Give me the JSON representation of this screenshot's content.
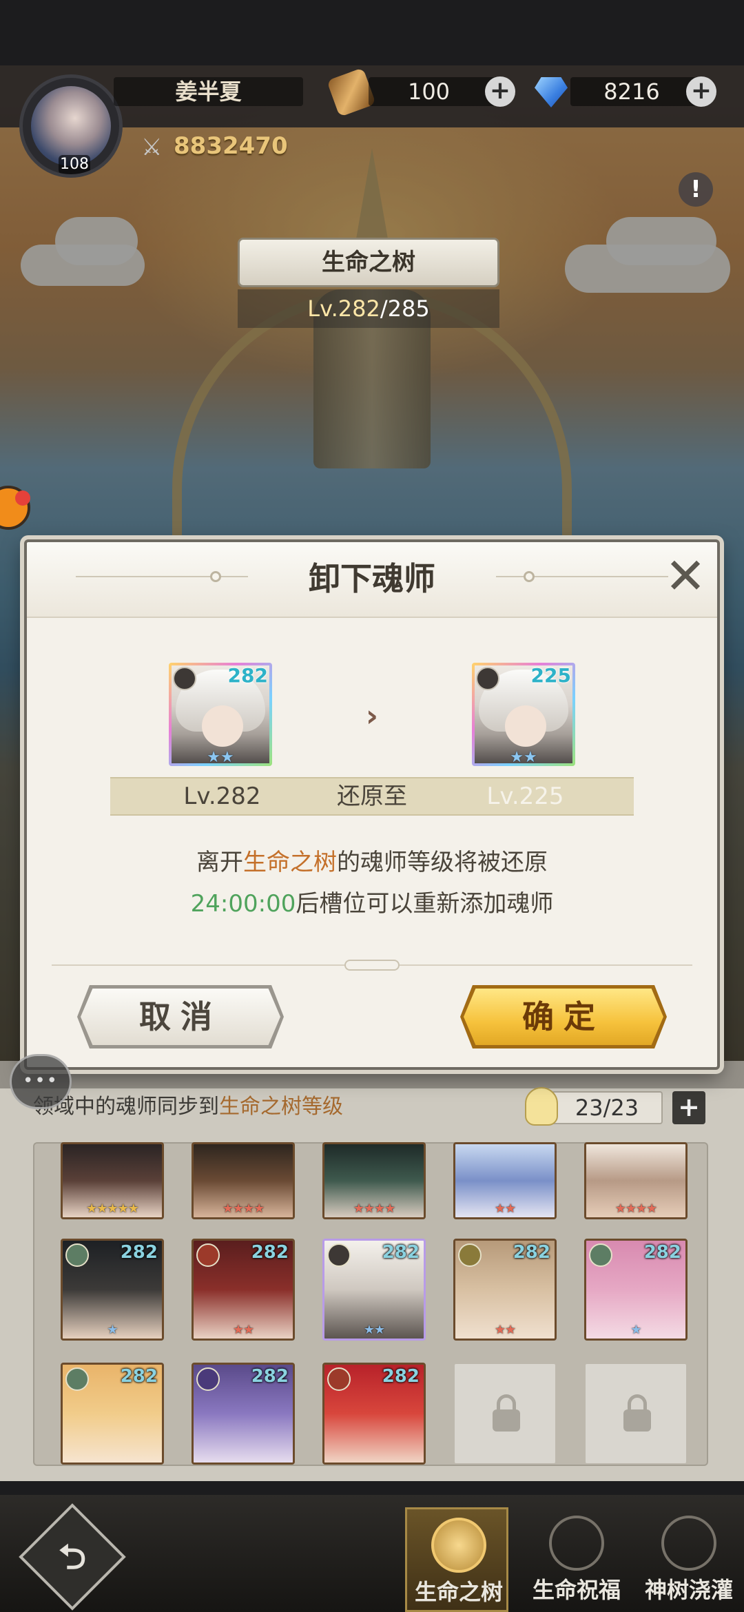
{
  "player": {
    "name": "姜半夏",
    "level": "108",
    "power": "8832470"
  },
  "resources": [
    {
      "icon": "scroll-icon",
      "value": "100"
    },
    {
      "icon": "gem-icon",
      "value": "8216"
    }
  ],
  "tree": {
    "title": "生命之树",
    "level_current": "Lv.282",
    "level_max": "/285"
  },
  "dialog": {
    "title": "卸下魂师",
    "from_level_badge": "282",
    "to_level_badge": "225",
    "from_level": "Lv.282",
    "restore_label": "还原至",
    "to_level": "Lv.225",
    "msg1_a": "离开",
    "msg1_b": "生命之树",
    "msg1_c": "的魂师等级将被还原",
    "msg2_a": "24:00:00",
    "msg2_b": "后槽位可以重新添加魂师",
    "cancel_label": "取消",
    "confirm_label": "确定"
  },
  "domain_panel": {
    "sync_text_a": "领域中的魂师同步到",
    "sync_text_b": "生命之树等级",
    "slot_count": "23/23",
    "slots_row1": [
      {
        "stars": "★★★★★",
        "star_class": "stars"
      },
      {
        "stars": "★★★★",
        "star_class": "stars red"
      },
      {
        "stars": "★★★★",
        "star_class": "stars red"
      },
      {
        "stars": "★★",
        "star_class": "stars red"
      },
      {
        "stars": "★★★★",
        "star_class": "stars red"
      }
    ],
    "slots_row2": [
      {
        "level": "282",
        "stars": "★",
        "star_class": "stars blue"
      },
      {
        "level": "282",
        "stars": "★★",
        "star_class": "stars red"
      },
      {
        "level": "282",
        "stars": "★★",
        "star_class": "stars blue"
      },
      {
        "level": "282",
        "stars": "★★",
        "star_class": "stars red"
      },
      {
        "level": "282",
        "stars": "★",
        "star_class": "stars blue"
      }
    ],
    "slots_row3": [
      {
        "level": "282"
      },
      {
        "level": "282"
      },
      {
        "level": "282"
      }
    ]
  },
  "bottom_nav": {
    "back_glyph": "⮌",
    "tabs": [
      {
        "label": "生命之树",
        "active": true
      },
      {
        "label": "生命祝福",
        "active": false
      },
      {
        "label": "神树浇灌",
        "active": false
      }
    ]
  },
  "info_glyph": "!",
  "close_glyph": "✕",
  "plus_glyph": "+",
  "arrow_glyph": "›",
  "colors": {
    "accent_gold": "#f6c23c",
    "highlight_orange": "#c4702a",
    "timer_green": "#4fa35c",
    "level_cyan": "#2db2c8"
  }
}
